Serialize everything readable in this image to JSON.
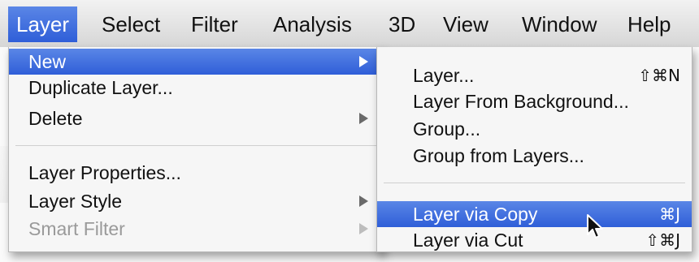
{
  "menubar": {
    "items": [
      "Layer",
      "Select",
      "Filter",
      "Analysis",
      "3D",
      "View",
      "Window",
      "Help"
    ],
    "active_index": 0
  },
  "layer_menu": {
    "items": [
      {
        "label": "New",
        "submenu": true,
        "highlighted": true
      },
      {
        "label": "Duplicate Layer...",
        "submenu": false
      },
      {
        "label": "Delete",
        "submenu": true
      },
      {
        "label": "Layer Properties...",
        "submenu": false
      },
      {
        "label": "Layer Style",
        "submenu": true
      },
      {
        "label": "Smart Filter",
        "submenu": true,
        "disabled": true
      }
    ]
  },
  "new_submenu": {
    "items": [
      {
        "label": "Layer...",
        "shortcut": "⇧⌘N"
      },
      {
        "label": "Layer From Background...",
        "shortcut": ""
      },
      {
        "label": "Group...",
        "shortcut": ""
      },
      {
        "label": "Group from Layers...",
        "shortcut": ""
      },
      {
        "label": "Layer via Copy",
        "shortcut": "⌘J",
        "highlighted": true
      },
      {
        "label": "Layer via Cut",
        "shortcut": "⇧⌘J"
      }
    ]
  },
  "colors": {
    "highlight": "#3a68dc",
    "menu_bg": "#f6f6f6",
    "disabled_text": "#9a9a9a"
  },
  "icons": {
    "submenu_arrow": "triangle-right-icon",
    "cursor": "mouse-pointer-icon"
  }
}
